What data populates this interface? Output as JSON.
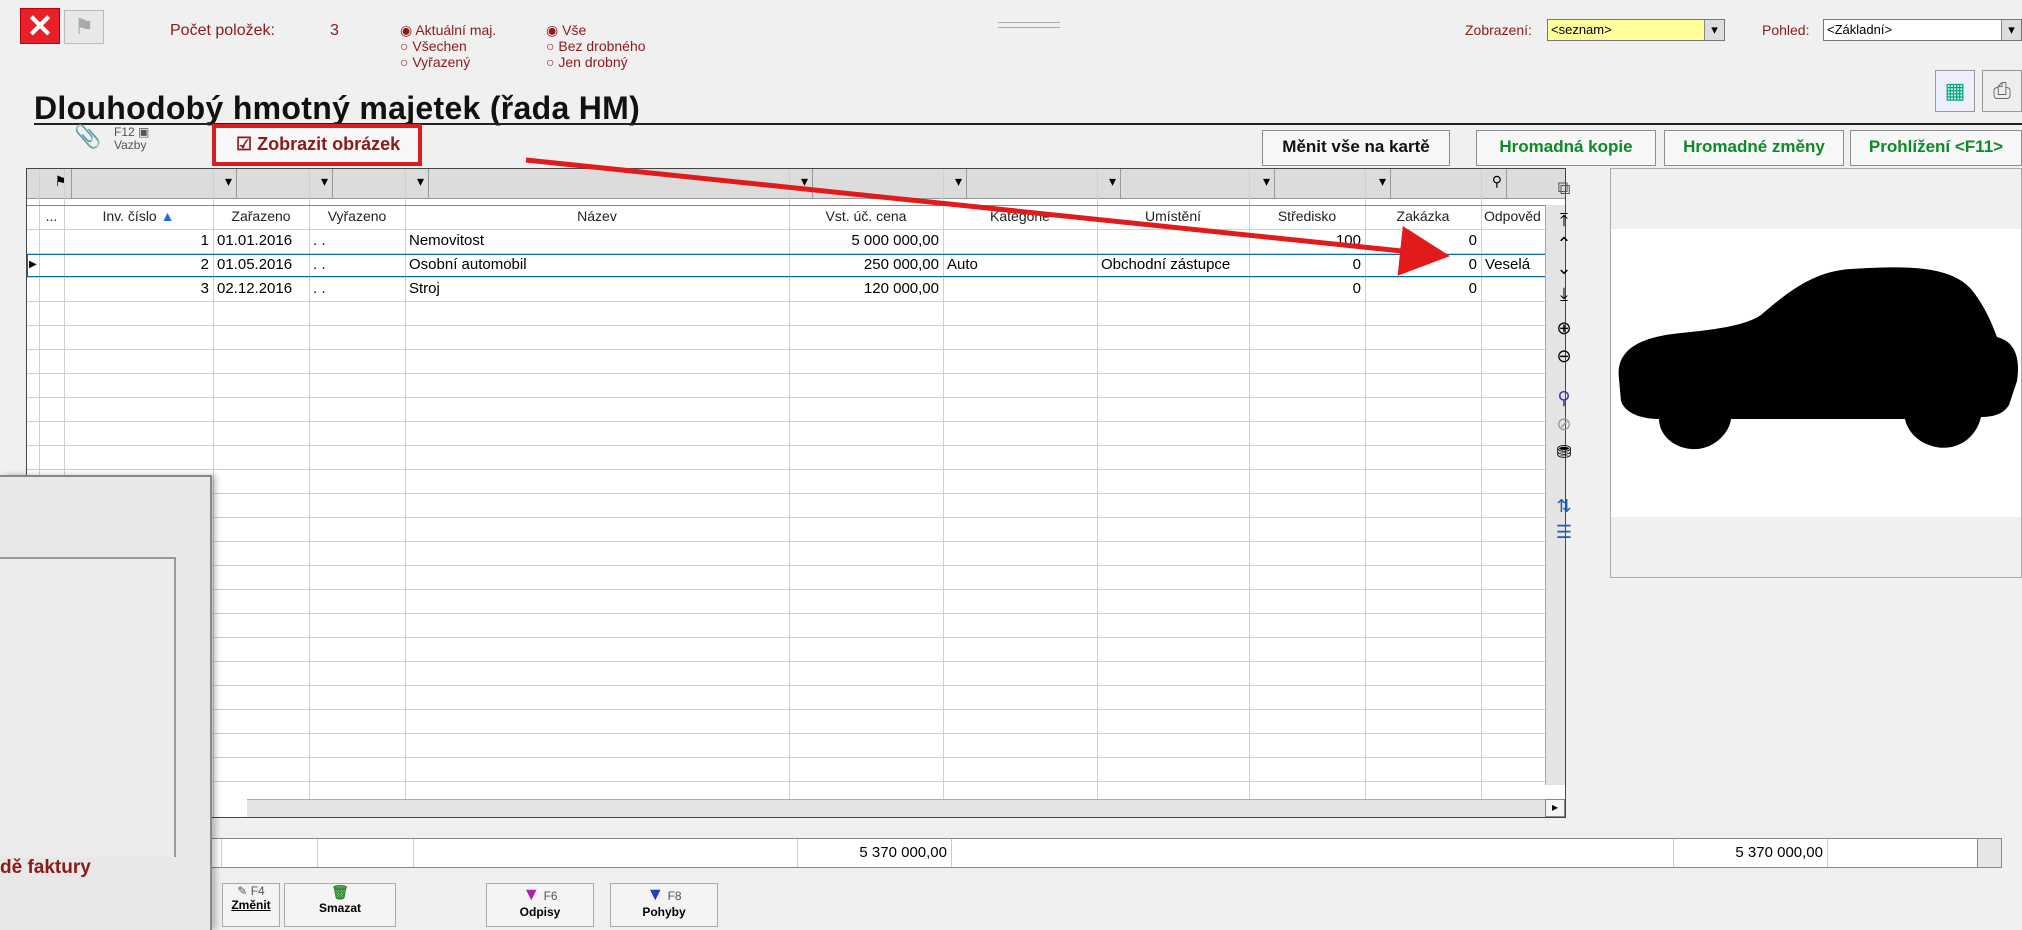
{
  "window": {
    "close_icon": "close-x-icon",
    "flag_icon": "flag-icon"
  },
  "header": {
    "count_label": "Počet položek:",
    "count_value": "3",
    "title": "Dlouhodobý hmotný majetek (řada HM)"
  },
  "filters": {
    "group1": [
      {
        "label": "Aktuální maj.",
        "selected": true
      },
      {
        "label": "Všechen",
        "selected": false
      },
      {
        "label": "Vyřazený",
        "selected": false
      }
    ],
    "group2": [
      {
        "label": "Vše",
        "selected": true
      },
      {
        "label": "Bez drobného",
        "selected": false
      },
      {
        "label": "Jen drobný",
        "selected": false
      }
    ]
  },
  "view": {
    "display_label": "Zobrazení:",
    "display_value": "<seznam>",
    "pohled_label": "Pohled:",
    "pohled_value": "<Základní>"
  },
  "links": {
    "f12_label": "F12",
    "vazby_label": "Vazby",
    "show_image_label": "Zobrazit obrázek",
    "show_image_checked": true
  },
  "actions": {
    "menit_vse": "Měnit vše na kartě",
    "hromadna_kopie": "Hromadná kopie",
    "hromadne_zmeny": "Hromadné změny",
    "prohlizeni": "Prohlížení <F11>"
  },
  "table": {
    "columns": [
      "...",
      "Inv. číslo",
      "Zařazeno",
      "Vyřazeno",
      "Název",
      "Vst. úč. cena",
      "Kategorie",
      "Umístění",
      "Středisko",
      "Zakázka",
      "Odpověd"
    ],
    "rows": [
      {
        "inv": "1",
        "zarazeno": "01.01.2016",
        "vyrazeno": ". .",
        "nazev": "Nemovitost",
        "cena": "5 000 000,00",
        "kategorie": "",
        "umisteni": "",
        "stredisko": "100",
        "zakazka": "0",
        "odpoved": ""
      },
      {
        "inv": "2",
        "zarazeno": "01.05.2016",
        "vyrazeno": ". .",
        "nazev": "Osobní automobil",
        "cena": "250 000,00",
        "kategorie": "Auto",
        "umisteni": "Obchodní zástupce",
        "stredisko": "0",
        "zakazka": "0",
        "odpoved": "Veselá"
      },
      {
        "inv": "3",
        "zarazeno": "02.12.2016",
        "vyrazeno": ". .",
        "nazev": "Stroj",
        "cena": "120 000,00",
        "kategorie": "",
        "umisteni": "",
        "stredisko": "0",
        "zakazka": "0",
        "odpoved": ""
      }
    ]
  },
  "totals": {
    "cena_total": "5 370 000,00",
    "right_total": "5 370 000,00"
  },
  "toolbar": {
    "zmenit_key": "F4",
    "zmenit": "Změnit",
    "smazat": "Smazat",
    "odpisy_key": "F6",
    "odpisy": "Odpisy",
    "pohyby_key": "F8",
    "pohyby": "Pohyby"
  },
  "dialog": {
    "partial_text": "dě faktury"
  },
  "annotation": {
    "color": "#e11b1b"
  }
}
